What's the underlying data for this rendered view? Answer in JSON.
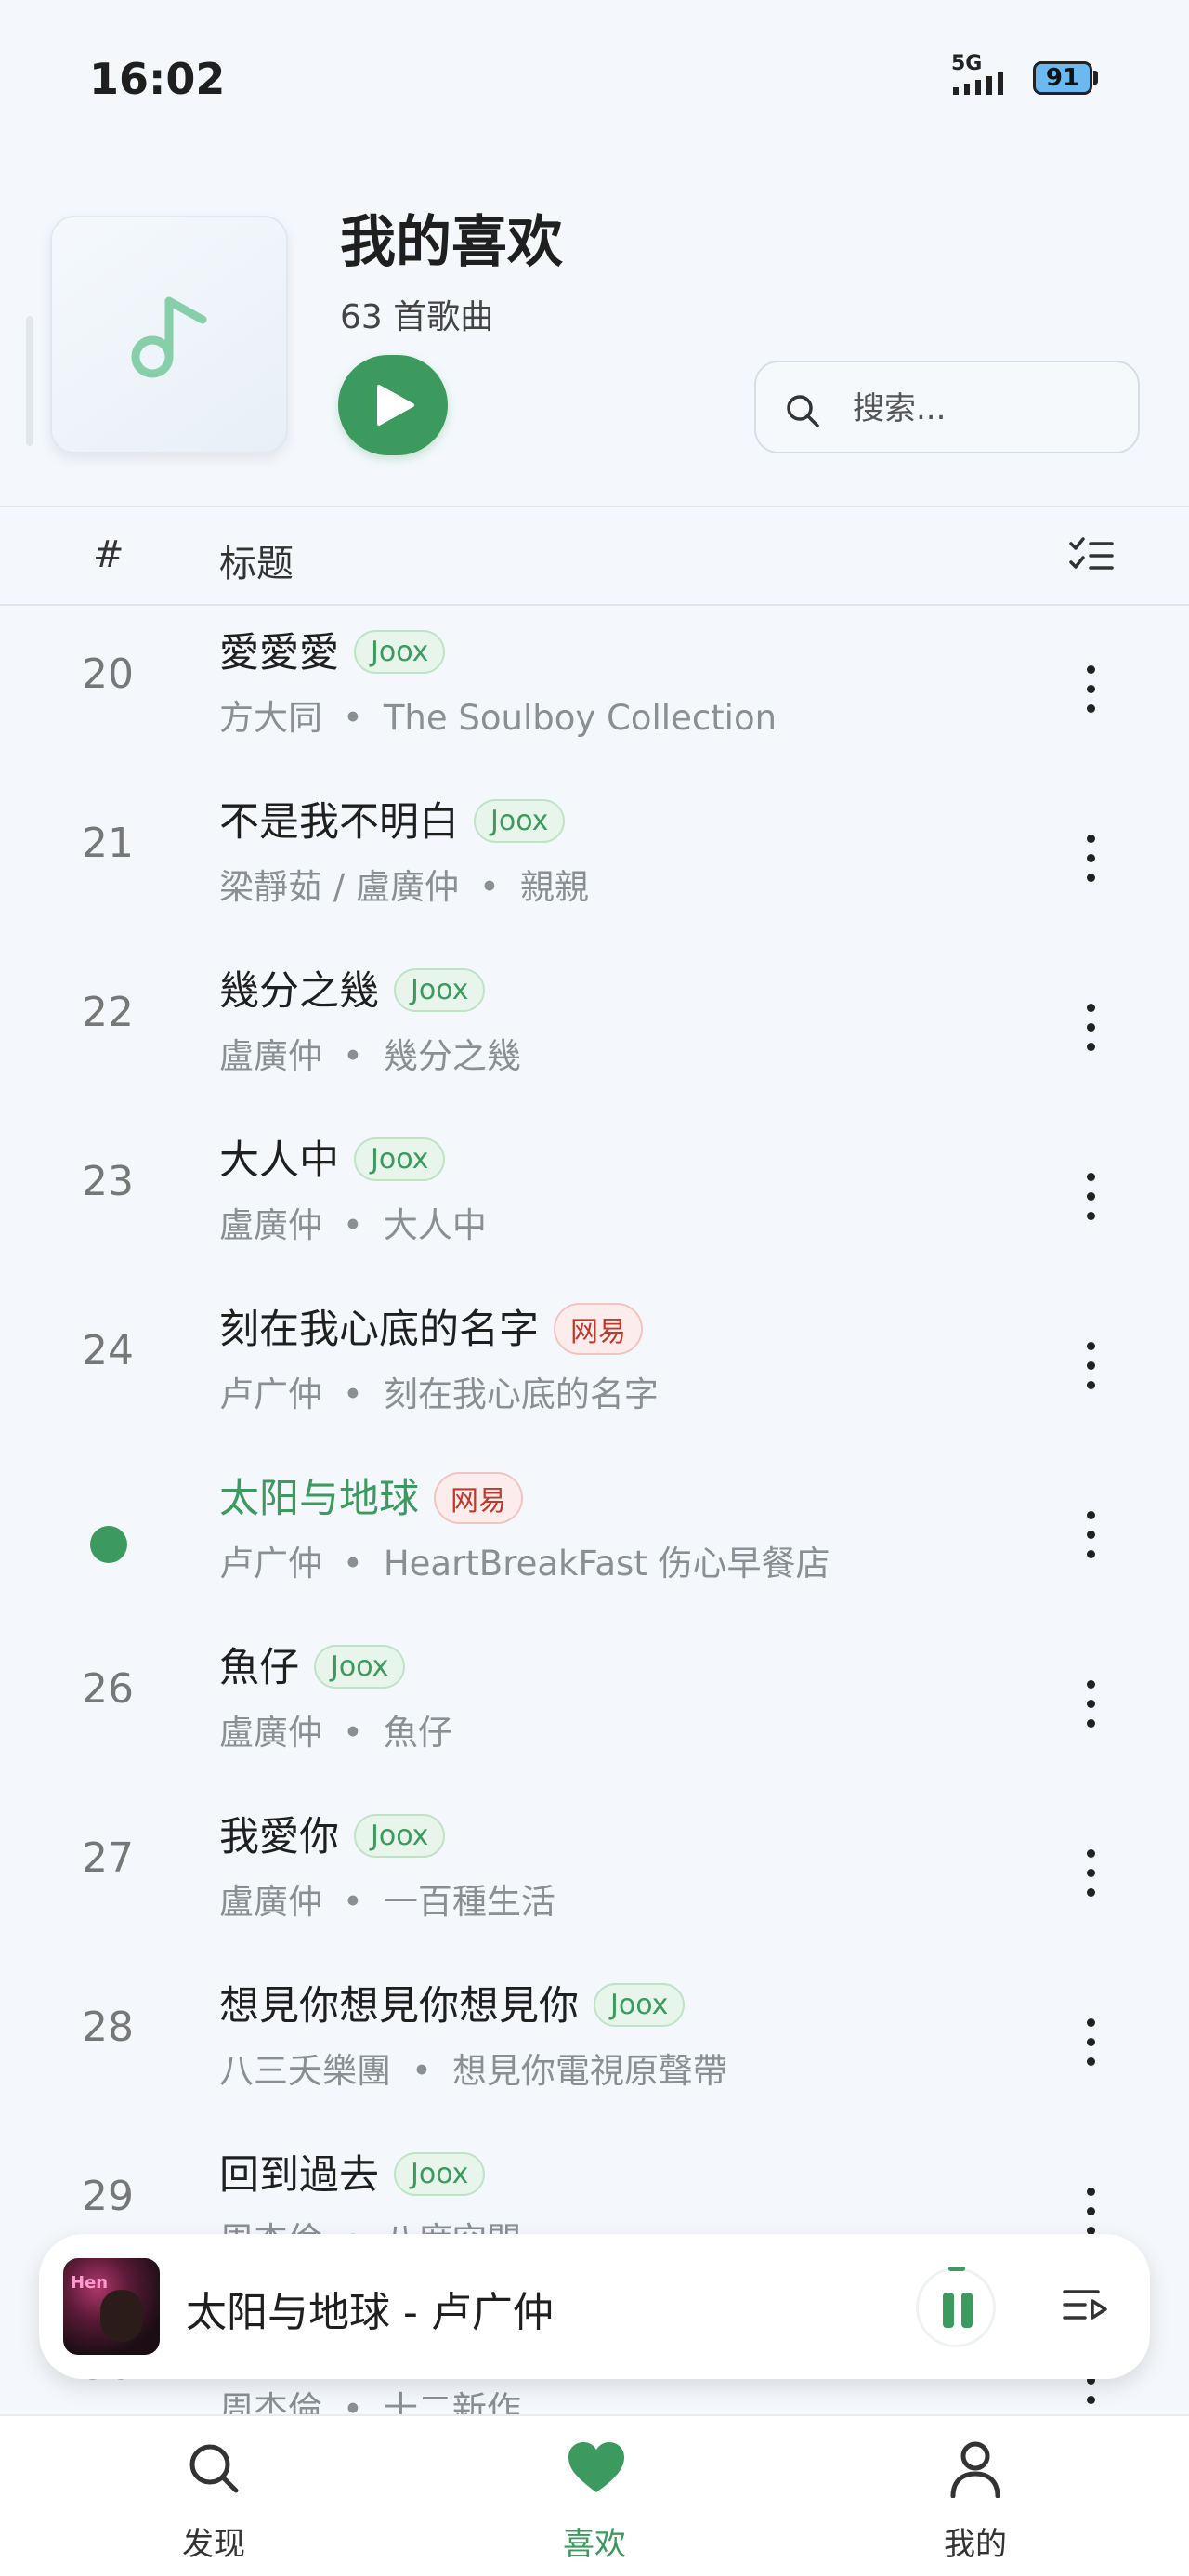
{
  "status_bar": {
    "time": "16:02",
    "network": "5G",
    "battery": "91"
  },
  "playlist": {
    "title": "我的喜欢",
    "song_count": "63 首歌曲",
    "search_placeholder": "搜索..."
  },
  "table_header": {
    "index_col": "#",
    "title_col": "标题"
  },
  "songs": [
    {
      "index": "20",
      "title": "愛愛愛",
      "source": "Joox",
      "artist": "方大同",
      "album": "The Soulboy Collection",
      "playing": false
    },
    {
      "index": "21",
      "title": "不是我不明白",
      "source": "Joox",
      "artist": "梁靜茹 / 盧廣仲",
      "album": "親親",
      "playing": false
    },
    {
      "index": "22",
      "title": "幾分之幾",
      "source": "Joox",
      "artist": "盧廣仲",
      "album": "幾分之幾",
      "playing": false
    },
    {
      "index": "23",
      "title": "大人中",
      "source": "Joox",
      "artist": "盧廣仲",
      "album": "大人中",
      "playing": false
    },
    {
      "index": "24",
      "title": "刻在我心底的名字",
      "source": "网易",
      "artist": "卢广仲",
      "album": "刻在我心底的名字",
      "playing": false
    },
    {
      "index": "",
      "title": "太阳与地球",
      "source": "网易",
      "artist": "卢广仲",
      "album": "HeartBreakFast 伤心早餐店",
      "playing": true
    },
    {
      "index": "26",
      "title": "魚仔",
      "source": "Joox",
      "artist": "盧廣仲",
      "album": "魚仔",
      "playing": false
    },
    {
      "index": "27",
      "title": "我愛你",
      "source": "Joox",
      "artist": "盧廣仲",
      "album": "一百種生活",
      "playing": false
    },
    {
      "index": "28",
      "title": "想見你想見你想見你",
      "source": "Joox",
      "artist": "八三夭樂團",
      "album": "想見你電視原聲帶",
      "playing": false
    },
    {
      "index": "29",
      "title": "回到過去",
      "source": "Joox",
      "artist": "周杰倫",
      "album": "八度空間",
      "playing": false
    },
    {
      "index": "30",
      "title": "",
      "source": "",
      "artist": "周杰倫",
      "album": "十二新作",
      "playing": false
    }
  ],
  "mini_player": {
    "now_playing": "太阳与地球 - 卢广仲",
    "art_text": "Hen"
  },
  "bottom_nav": [
    {
      "label": "发现",
      "icon": "search-icon",
      "active": false
    },
    {
      "label": "喜欢",
      "icon": "heart-icon",
      "active": true
    },
    {
      "label": "我的",
      "icon": "person-icon",
      "active": false
    }
  ],
  "colors": {
    "accent": "#3c9a5f",
    "joox_badge": "#3c9a5f",
    "netease_badge": "#c0392b",
    "background": "#f4f8fc"
  }
}
